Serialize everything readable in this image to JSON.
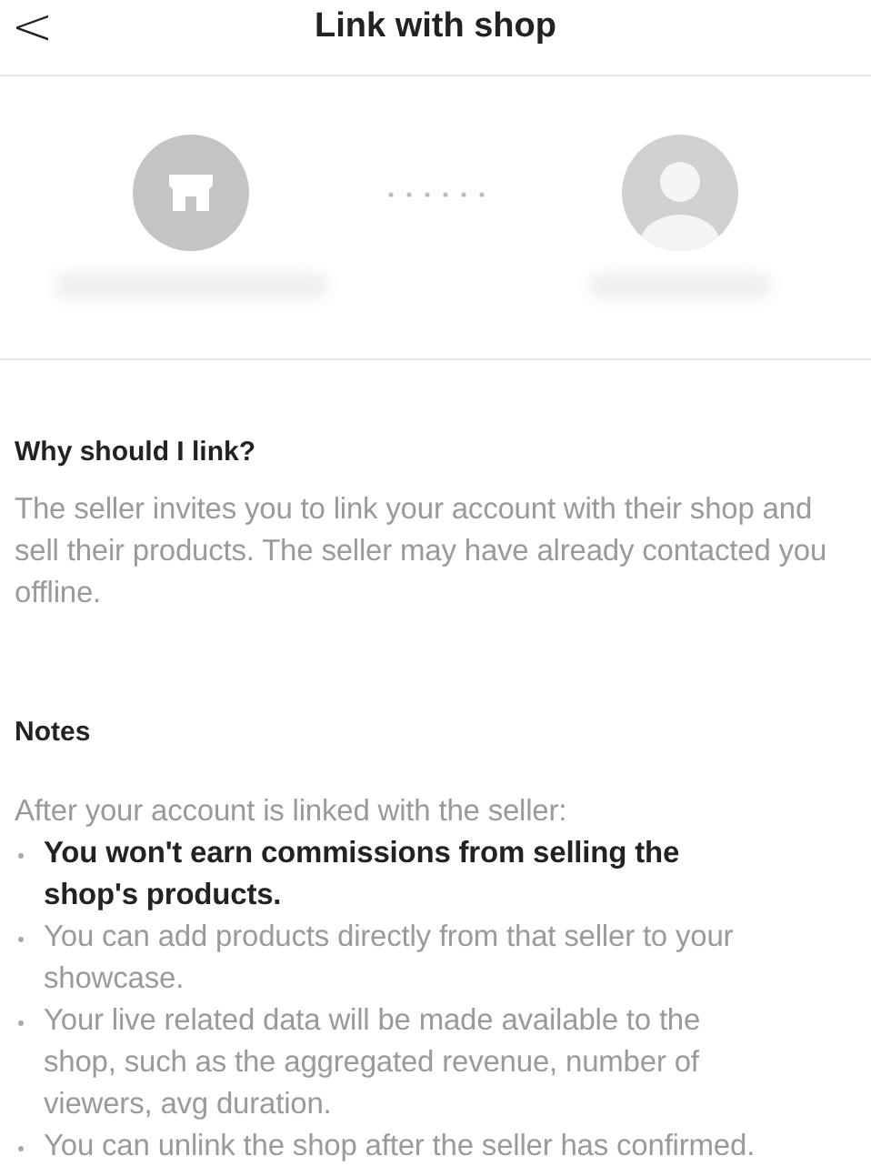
{
  "header": {
    "back": "<",
    "title": "Link with shop"
  },
  "why": {
    "heading": "Why should I link?",
    "body": "The seller invites you to link your account with their shop and sell their products. The seller may have already contacted you offline."
  },
  "notes": {
    "heading": "Notes",
    "intro": "After your account is linked with the seller:",
    "items": [
      {
        "text": "You won't earn commissions from selling the shop's products.",
        "bold": true
      },
      {
        "text": "You can add products directly from that seller to your showcase.",
        "bold": false
      },
      {
        "text": "Your live related data will be made available to the shop, such as the aggregated revenue, number of viewers, avg duration.",
        "bold": false
      },
      {
        "text": "You can unlink the shop after the seller has confirmed.",
        "bold": false
      }
    ]
  }
}
